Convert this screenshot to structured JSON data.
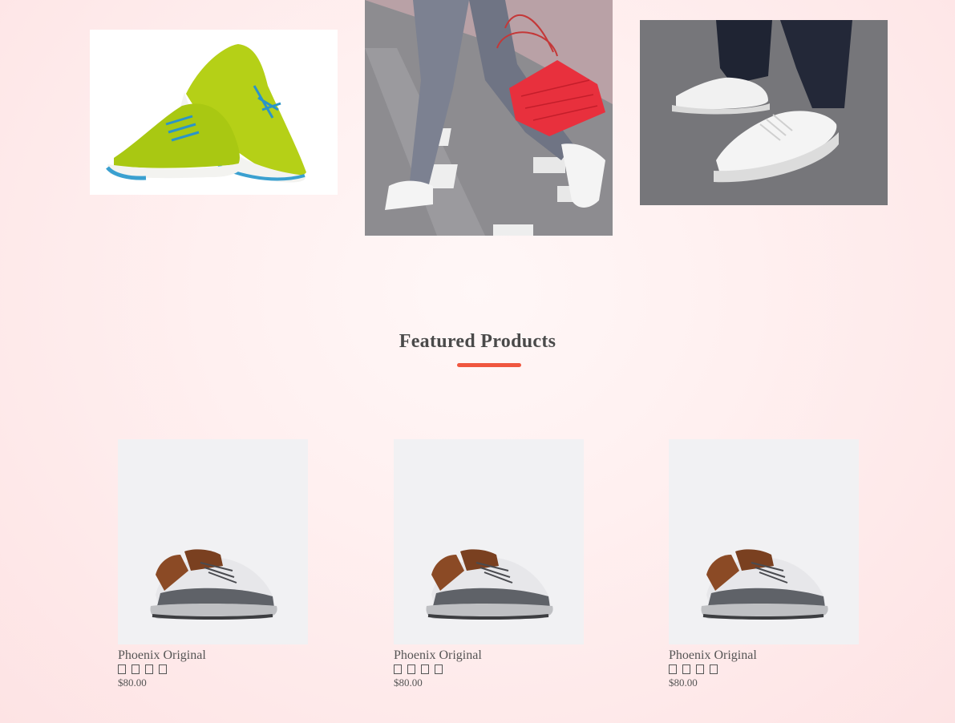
{
  "featured": {
    "title": "Featured Products",
    "accent_color": "#f0563f"
  },
  "hero_images": [
    {
      "name": "lime-sneakers-image"
    },
    {
      "name": "street-walk-red-bag-image"
    },
    {
      "name": "white-sneakers-street-image"
    }
  ],
  "products": [
    {
      "name": "Phoenix Original",
      "price": "$80.00",
      "rating": 4
    },
    {
      "name": "Phoenix Original",
      "price": "$80.00",
      "rating": 4
    },
    {
      "name": "Phoenix Original",
      "price": "$80.00",
      "rating": 4
    }
  ]
}
